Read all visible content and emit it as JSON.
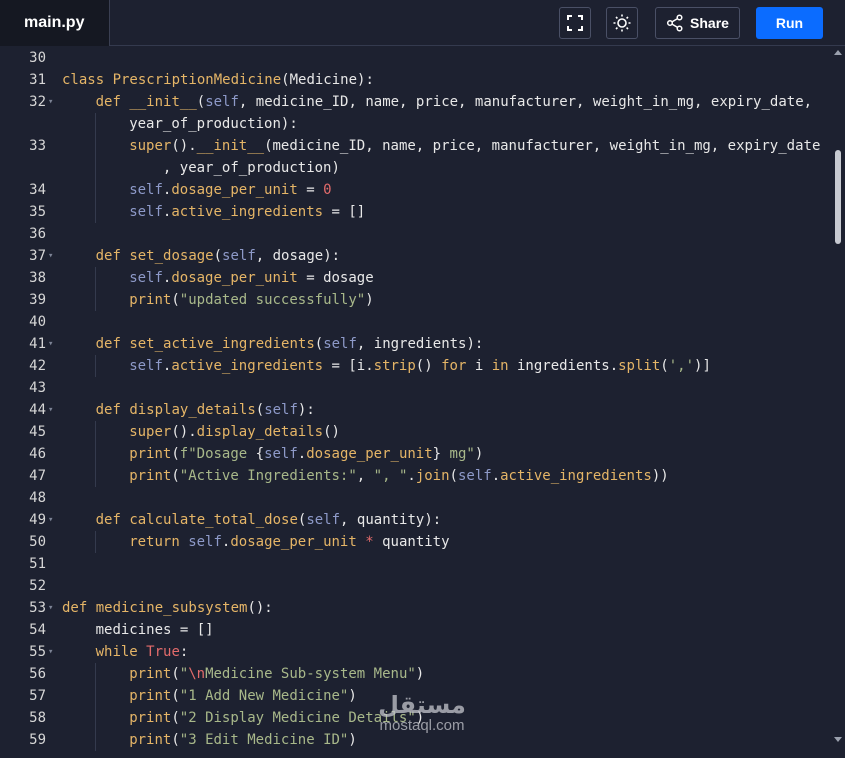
{
  "tab": {
    "filename": "main.py"
  },
  "toolbar": {
    "fullscreen_icon": "fullscreen-icon",
    "theme_icon": "sun-icon",
    "share_icon": "share-icon",
    "share_label": "Share",
    "run_label": "Run",
    "run_color": "#0b6cff"
  },
  "watermark": {
    "arabic": "مستقل",
    "latin": "mostaql.com"
  },
  "colors": {
    "background": "#1d2130",
    "keyword": "#e5b567",
    "string": "#a8b88a",
    "number": "#e36b6b",
    "self": "#8e9ac9"
  },
  "code": [
    {
      "num": "30",
      "fold": false,
      "indent": 0,
      "tokens": []
    },
    {
      "num": "31",
      "fold": false,
      "indent": 0,
      "tokens": [
        [
          "k",
          "class "
        ],
        [
          "c",
          "PrescriptionMedicine"
        ],
        [
          "p",
          "(Medicine):"
        ]
      ]
    },
    {
      "num": "32",
      "fold": true,
      "indent": 1,
      "tokens": [
        [
          "k",
          "def "
        ],
        [
          "f",
          "__init__"
        ],
        [
          "p",
          "("
        ],
        [
          "sl",
          "self"
        ],
        [
          "p",
          ", medicine_ID, name, price, manufacturer, weight_in_mg, expiry_date,"
        ]
      ]
    },
    {
      "num": "",
      "fold": false,
      "indent": 2,
      "tokens": [
        [
          "p",
          "year_of_production):"
        ]
      ]
    },
    {
      "num": "33",
      "fold": false,
      "indent": 2,
      "tokens": [
        [
          "f",
          "super"
        ],
        [
          "p",
          "()."
        ],
        [
          "f",
          "__init__"
        ],
        [
          "p",
          "(medicine_ID, name, price, manufacturer, weight_in_mg, expiry_date"
        ]
      ]
    },
    {
      "num": "",
      "fold": false,
      "indent": 2,
      "tokens": [
        [
          "p",
          "    , year_of_production)"
        ]
      ]
    },
    {
      "num": "34",
      "fold": false,
      "indent": 2,
      "tokens": [
        [
          "sl",
          "self"
        ],
        [
          "p",
          "."
        ],
        [
          "f",
          "dosage_per_unit"
        ],
        [
          "p",
          " = "
        ],
        [
          "n",
          "0"
        ]
      ]
    },
    {
      "num": "35",
      "fold": false,
      "indent": 2,
      "tokens": [
        [
          "sl",
          "self"
        ],
        [
          "p",
          "."
        ],
        [
          "f",
          "active_ingredients"
        ],
        [
          "p",
          " = []"
        ]
      ]
    },
    {
      "num": "36",
      "fold": false,
      "indent": 0,
      "tokens": []
    },
    {
      "num": "37",
      "fold": true,
      "indent": 1,
      "tokens": [
        [
          "k",
          "def "
        ],
        [
          "f",
          "set_dosage"
        ],
        [
          "p",
          "("
        ],
        [
          "sl",
          "self"
        ],
        [
          "p",
          ", dosage):"
        ]
      ]
    },
    {
      "num": "38",
      "fold": false,
      "indent": 2,
      "tokens": [
        [
          "sl",
          "self"
        ],
        [
          "p",
          "."
        ],
        [
          "f",
          "dosage_per_unit"
        ],
        [
          "p",
          " = dosage"
        ]
      ]
    },
    {
      "num": "39",
      "fold": false,
      "indent": 2,
      "tokens": [
        [
          "f",
          "print"
        ],
        [
          "p",
          "("
        ],
        [
          "s",
          "\"updated successfully\""
        ],
        [
          "p",
          ")"
        ]
      ]
    },
    {
      "num": "40",
      "fold": false,
      "indent": 0,
      "tokens": []
    },
    {
      "num": "41",
      "fold": true,
      "indent": 1,
      "tokens": [
        [
          "k",
          "def "
        ],
        [
          "f",
          "set_active_ingredients"
        ],
        [
          "p",
          "("
        ],
        [
          "sl",
          "self"
        ],
        [
          "p",
          ", ingredients):"
        ]
      ]
    },
    {
      "num": "42",
      "fold": false,
      "indent": 2,
      "tokens": [
        [
          "sl",
          "self"
        ],
        [
          "p",
          "."
        ],
        [
          "f",
          "active_ingredients"
        ],
        [
          "p",
          " = [i."
        ],
        [
          "f",
          "strip"
        ],
        [
          "p",
          "() "
        ],
        [
          "k",
          "for"
        ],
        [
          "p",
          " i "
        ],
        [
          "k",
          "in"
        ],
        [
          "p",
          " ingredients."
        ],
        [
          "f",
          "split"
        ],
        [
          "p",
          "("
        ],
        [
          "s",
          "','"
        ],
        [
          "p",
          ")]"
        ]
      ]
    },
    {
      "num": "43",
      "fold": false,
      "indent": 0,
      "tokens": []
    },
    {
      "num": "44",
      "fold": true,
      "indent": 1,
      "tokens": [
        [
          "k",
          "def "
        ],
        [
          "f",
          "display_details"
        ],
        [
          "p",
          "("
        ],
        [
          "sl",
          "self"
        ],
        [
          "p",
          "):"
        ]
      ]
    },
    {
      "num": "45",
      "fold": false,
      "indent": 2,
      "tokens": [
        [
          "f",
          "super"
        ],
        [
          "p",
          "()."
        ],
        [
          "f",
          "display_details"
        ],
        [
          "p",
          "()"
        ]
      ]
    },
    {
      "num": "46",
      "fold": false,
      "indent": 2,
      "tokens": [
        [
          "f",
          "print"
        ],
        [
          "p",
          "("
        ],
        [
          "s",
          "f\"Dosage "
        ],
        [
          "p",
          "{"
        ],
        [
          "sl",
          "self"
        ],
        [
          "p",
          "."
        ],
        [
          "f",
          "dosage_per_unit"
        ],
        [
          "p",
          "}"
        ],
        [
          "s",
          " mg\""
        ],
        [
          "p",
          ")"
        ]
      ]
    },
    {
      "num": "47",
      "fold": false,
      "indent": 2,
      "tokens": [
        [
          "f",
          "print"
        ],
        [
          "p",
          "("
        ],
        [
          "s",
          "\"Active Ingredients:\""
        ],
        [
          "p",
          ", "
        ],
        [
          "s",
          "\", \""
        ],
        [
          "p",
          "."
        ],
        [
          "f",
          "join"
        ],
        [
          "p",
          "("
        ],
        [
          "sl",
          "self"
        ],
        [
          "p",
          "."
        ],
        [
          "f",
          "active_ingredients"
        ],
        [
          "p",
          "))"
        ]
      ]
    },
    {
      "num": "48",
      "fold": false,
      "indent": 0,
      "tokens": []
    },
    {
      "num": "49",
      "fold": true,
      "indent": 1,
      "tokens": [
        [
          "k",
          "def "
        ],
        [
          "f",
          "calculate_total_dose"
        ],
        [
          "p",
          "("
        ],
        [
          "sl",
          "self"
        ],
        [
          "p",
          ", quantity):"
        ]
      ]
    },
    {
      "num": "50",
      "fold": false,
      "indent": 2,
      "tokens": [
        [
          "k",
          "return "
        ],
        [
          "sl",
          "self"
        ],
        [
          "p",
          "."
        ],
        [
          "f",
          "dosage_per_unit"
        ],
        [
          "p",
          " "
        ],
        [
          "n",
          "*"
        ],
        [
          "p",
          " quantity"
        ]
      ]
    },
    {
      "num": "51",
      "fold": false,
      "indent": 0,
      "tokens": []
    },
    {
      "num": "52",
      "fold": false,
      "indent": 0,
      "tokens": []
    },
    {
      "num": "53",
      "fold": true,
      "indent": 0,
      "tokens": [
        [
          "k",
          "def "
        ],
        [
          "f",
          "medicine_subsystem"
        ],
        [
          "p",
          "():"
        ]
      ]
    },
    {
      "num": "54",
      "fold": false,
      "indent": 1,
      "tokens": [
        [
          "p",
          "medicines = []"
        ]
      ]
    },
    {
      "num": "55",
      "fold": true,
      "indent": 1,
      "tokens": [
        [
          "k",
          "while "
        ],
        [
          "n",
          "True"
        ],
        [
          "p",
          ":"
        ]
      ]
    },
    {
      "num": "56",
      "fold": false,
      "indent": 2,
      "tokens": [
        [
          "f",
          "print"
        ],
        [
          "p",
          "("
        ],
        [
          "s",
          "\""
        ],
        [
          "n",
          "\\n"
        ],
        [
          "s",
          "Medicine Sub-system Menu\""
        ],
        [
          "p",
          ")"
        ]
      ]
    },
    {
      "num": "57",
      "fold": false,
      "indent": 2,
      "tokens": [
        [
          "f",
          "print"
        ],
        [
          "p",
          "("
        ],
        [
          "s",
          "\"1 Add New Medicine\""
        ],
        [
          "p",
          ")"
        ]
      ]
    },
    {
      "num": "58",
      "fold": false,
      "indent": 2,
      "tokens": [
        [
          "f",
          "print"
        ],
        [
          "p",
          "("
        ],
        [
          "s",
          "\"2 Display Medicine Details\""
        ],
        [
          "p",
          ")"
        ]
      ]
    },
    {
      "num": "59",
      "fold": false,
      "indent": 2,
      "tokens": [
        [
          "f",
          "print"
        ],
        [
          "p",
          "("
        ],
        [
          "s",
          "\"3 Edit Medicine ID\""
        ],
        [
          "p",
          ")"
        ]
      ]
    }
  ]
}
